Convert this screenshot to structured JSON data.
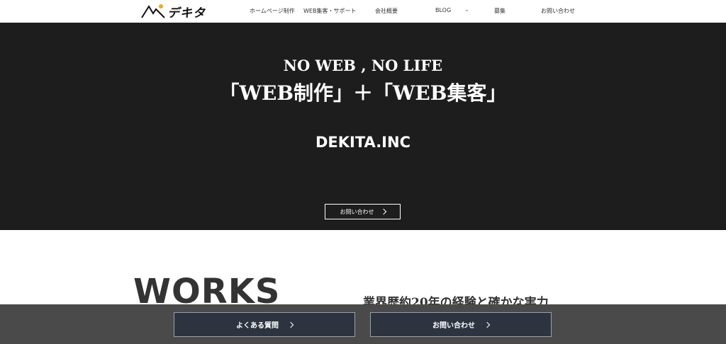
{
  "header": {
    "logo_text": "デキタ",
    "nav": [
      {
        "label": "ホームページ制作"
      },
      {
        "label": "WEB集客・サポート"
      },
      {
        "label": "会社概要"
      },
      {
        "label": "BLOG"
      },
      {
        "label": "募集"
      },
      {
        "label": "お問い合わせ"
      }
    ]
  },
  "hero": {
    "line1": "NO WEB , NO LIFE",
    "line2": "「WEB制作」＋「WEB集客」",
    "company": "DEKITA.INC",
    "cta_label": "お問い合わせ"
  },
  "works": {
    "title": "WORKS",
    "subtitle": "業界歴約20年の経験と確かな実力"
  },
  "bottom_bar": {
    "faq_label": "よくある質問",
    "contact_label": "お問い合わせ"
  },
  "colors": {
    "hero_bg": "#1d1d1d",
    "bottom_bar_bg": "#4a4a4a",
    "bottom_button_bg": "#2d3440"
  }
}
